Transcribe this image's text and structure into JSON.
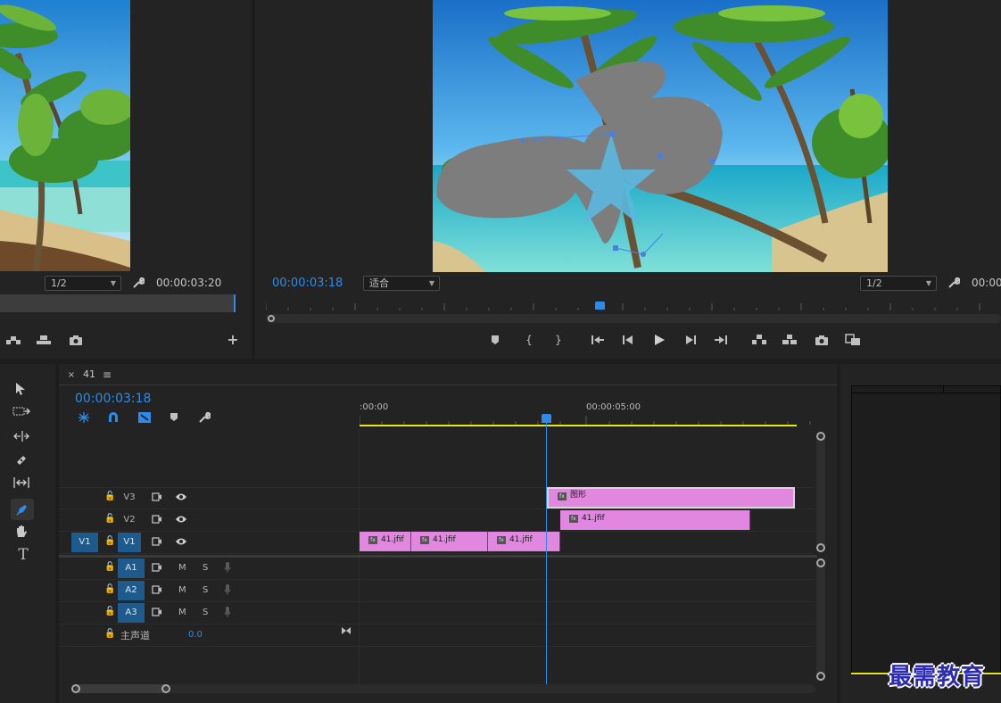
{
  "source_monitor": {
    "resolution": "1/2",
    "timecode": "00:00:03:20"
  },
  "program_monitor": {
    "timecode": "00:00:03:18",
    "fit_label": "适合",
    "resolution": "1/2",
    "timecode_right": "00:00"
  },
  "timeline": {
    "sequence_name": "41",
    "timecode": "00:00:03:18",
    "ruler_labels": [
      ":00:00",
      "00:00:05:00"
    ],
    "video_tracks": [
      {
        "name": "V3",
        "clips": [
          {
            "label": "图形"
          }
        ]
      },
      {
        "name": "V2",
        "clips": [
          {
            "label": "41.jfif"
          }
        ]
      },
      {
        "name": "V1",
        "source": "V1",
        "clips": [
          {
            "label": "41.jfif"
          },
          {
            "label": "41.jfif"
          },
          {
            "label": "41.jfif"
          }
        ]
      }
    ],
    "audio_tracks": [
      {
        "name": "A1",
        "m": "M",
        "s": "S"
      },
      {
        "name": "A2",
        "m": "M",
        "s": "S"
      },
      {
        "name": "A3",
        "m": "M",
        "s": "S"
      }
    ],
    "master": {
      "label": "主声道",
      "value": "0.0"
    }
  },
  "watermark": "最需教育",
  "colors": {
    "accent": "#2d8ceb",
    "clip": "#e287e0",
    "track_selected": "#1f5a8c",
    "work_area": "#e6e619"
  },
  "tools": [
    "selection-tool-icon",
    "track-select-icon",
    "ripple-edit-icon",
    "razor-icon",
    "slip-icon",
    "pen-icon",
    "hand-icon",
    "type-icon"
  ]
}
